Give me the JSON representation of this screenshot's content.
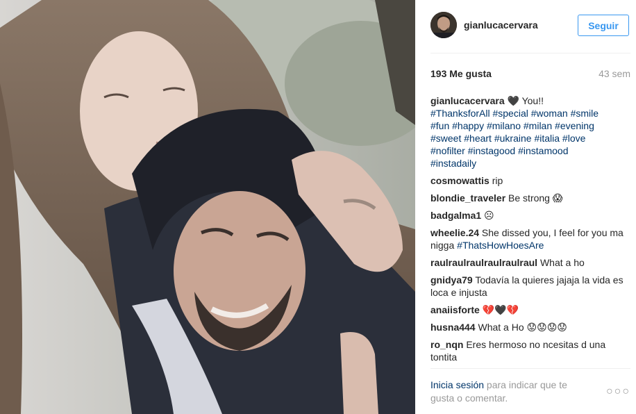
{
  "post": {
    "username": "gianlucacervara",
    "follow_label": "Seguir",
    "likes": "193 Me gusta",
    "time_ago": "43 sem"
  },
  "caption": {
    "username": "gianlucacervara",
    "text": " 🖤 You!!",
    "hashtags": [
      "#ThanksforAll",
      "#special",
      "#woman",
      "#smile",
      "#fun",
      "#happy",
      "#milano",
      "#milan",
      "#evening",
      "#sweet",
      "#heart",
      "#ukraine",
      "#italia",
      "#love",
      "#nofilter",
      "#instagood",
      "#instamood",
      "#instadaily"
    ]
  },
  "comments": [
    {
      "user": "cosmowattis",
      "text": " rip"
    },
    {
      "user": "blondie_traveler",
      "text": " Be strong 😱"
    },
    {
      "user": "badgalma1",
      "text": " ☹"
    },
    {
      "user": "wheelie.24",
      "text": " She dissed you, I feel for you ma nigga ",
      "tag": "#ThatsHowHoesAre"
    },
    {
      "user": "raulraulraulraulraulraul",
      "text": " What a ho"
    },
    {
      "user": "gnidya79",
      "text": " Todavía la quieres jajaja la vida es loca e injusta"
    },
    {
      "user": "anaiisforte",
      "text": " 💔🖤💔"
    },
    {
      "user": "husna444",
      "text": " What a Ho 😟😟😟😟"
    },
    {
      "user": "ro_nqn",
      "text": " Eres hermoso no ncesitas d una tontita"
    }
  ],
  "footer": {
    "login_link": "Inicia sesión",
    "rest": " para indicar que te gusta o comentar.",
    "more_label": "○○○"
  }
}
